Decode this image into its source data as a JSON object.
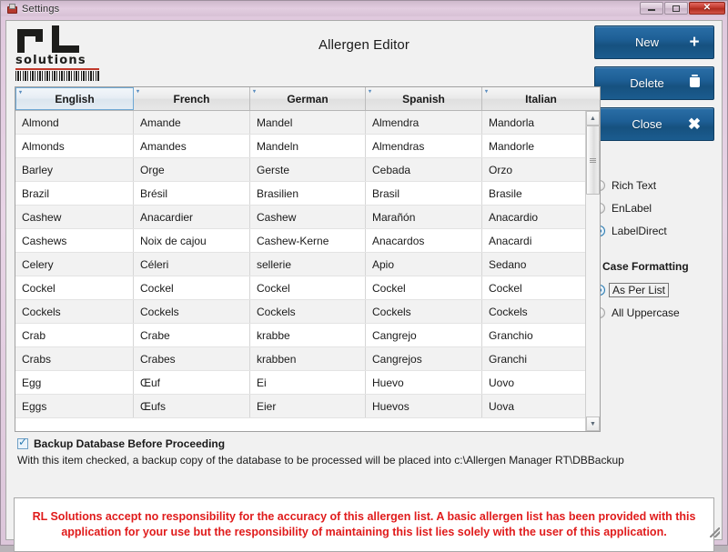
{
  "window": {
    "title": "Settings",
    "icon": "app-icon",
    "buttons": {
      "minimize": "minimize-icon",
      "maximize": "maximize-icon",
      "close": "✕"
    }
  },
  "header": {
    "page_title": "Allergen Editor",
    "logo": {
      "mark": "rl",
      "word": "solutions",
      "barcode": "barcode-icon"
    }
  },
  "actions": [
    {
      "label": "New",
      "icon": "plus-icon",
      "name": "new-button"
    },
    {
      "label": "Delete",
      "icon": "trash-icon",
      "name": "delete-button"
    },
    {
      "label": "Close",
      "icon": "close-x-icon",
      "name": "close-button"
    }
  ],
  "output_format": {
    "options": [
      {
        "label": "Rich Text",
        "selected": false
      },
      {
        "label": "EnLabel",
        "selected": false
      },
      {
        "label": "LabelDirect",
        "selected": true
      }
    ]
  },
  "case_formatting": {
    "title": "Case Formatting",
    "options": [
      {
        "label": "As Per List",
        "selected": true,
        "focused": true
      },
      {
        "label": "All Uppercase",
        "selected": false,
        "focused": false
      }
    ]
  },
  "grid": {
    "columns": [
      "English",
      "French",
      "German",
      "Spanish",
      "Italian"
    ],
    "selected_column": "English",
    "rows": [
      [
        "Almond",
        "Amande",
        "Mandel",
        "Almendra",
        "Mandorla"
      ],
      [
        "Almonds",
        "Amandes",
        "Mandeln",
        "Almendras",
        "Mandorle"
      ],
      [
        "Barley",
        "Orge",
        "Gerste",
        "Cebada",
        "Orzo"
      ],
      [
        "Brazil",
        "Brésil",
        "Brasilien",
        "Brasil",
        "Brasile"
      ],
      [
        "Cashew",
        "Anacardier",
        "Cashew",
        "Marañón",
        "Anacardio"
      ],
      [
        "Cashews",
        "Noix de cajou",
        "Cashew-Kerne",
        "Anacardos",
        "Anacardi"
      ],
      [
        "Celery",
        "Céleri",
        "sellerie",
        "Apio",
        "Sedano"
      ],
      [
        "Cockel",
        "Cockel",
        "Cockel",
        "Cockel",
        "Cockel"
      ],
      [
        "Cockels",
        "Cockels",
        "Cockels",
        "Cockels",
        "Cockels"
      ],
      [
        "Crab",
        "Crabe",
        "krabbe",
        "Cangrejo",
        "Granchio"
      ],
      [
        "Crabs",
        "Crabes",
        "krabben",
        "Cangrejos",
        "Granchi"
      ],
      [
        "Egg",
        "Œuf",
        "Ei",
        "Huevo",
        "Uovo"
      ],
      [
        "Eggs",
        "Œufs",
        "Eier",
        "Huevos",
        "Uova"
      ]
    ],
    "scrollbar": {
      "up": "▲",
      "down": "▼"
    }
  },
  "backup": {
    "checked": true,
    "label": "Backup Database Before Proceeding",
    "description": "With this item checked, a backup copy of the database to be processed will be placed into c:\\Allergen Manager RT\\DBBackup"
  },
  "disclaimer": {
    "text": "RL Solutions accept no responsibility for the accuracy of this allergen list.  A basic allergen list has been provided with this application for your use but the responsibility of maintaining this list lies solely with the user of this application."
  },
  "colors": {
    "accent_blue": "#1e5f96",
    "disclaimer_red": "#e01b1b",
    "chrome": "#dcc6da"
  }
}
